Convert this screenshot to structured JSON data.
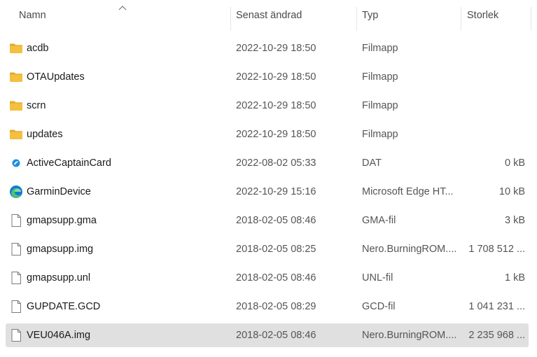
{
  "columns": {
    "name": "Namn",
    "date": "Senast ändrad",
    "type": "Typ",
    "size": "Storlek"
  },
  "files": [
    {
      "name": "acdb",
      "date": "2022-10-29 18:50",
      "type": "Filmapp",
      "size": "",
      "icon": "folder-icon"
    },
    {
      "name": "OTAUpdates",
      "date": "2022-10-29 18:50",
      "type": "Filmapp",
      "size": "",
      "icon": "folder-icon"
    },
    {
      "name": "scrn",
      "date": "2022-10-29 18:50",
      "type": "Filmapp",
      "size": "",
      "icon": "folder-icon"
    },
    {
      "name": "updates",
      "date": "2022-10-29 18:50",
      "type": "Filmapp",
      "size": "",
      "icon": "folder-icon"
    },
    {
      "name": "ActiveCaptainCard",
      "date": "2022-08-02 05:33",
      "type": "DAT",
      "size": "0 kB",
      "icon": "activecaptain-icon"
    },
    {
      "name": "GarminDevice",
      "date": "2022-10-29 15:16",
      "type": "Microsoft Edge HT...",
      "size": "10 kB",
      "icon": "edge-icon"
    },
    {
      "name": "gmapsupp.gma",
      "date": "2018-02-05 08:46",
      "type": "GMA-fil",
      "size": "3 kB",
      "icon": "file-icon"
    },
    {
      "name": "gmapsupp.img",
      "date": "2018-02-05 08:25",
      "type": "Nero.BurningROM....",
      "size": "1 708 512 ...",
      "icon": "file-icon"
    },
    {
      "name": "gmapsupp.unl",
      "date": "2018-02-05 08:46",
      "type": "UNL-fil",
      "size": "1 kB",
      "icon": "file-icon"
    },
    {
      "name": "GUPDATE.GCD",
      "date": "2018-02-05 08:29",
      "type": "GCD-fil",
      "size": "1 041 231 ...",
      "icon": "file-icon"
    },
    {
      "name": "VEU046A.img",
      "date": "2018-02-05 08:46",
      "type": "Nero.BurningROM....",
      "size": "2 235 968 ...",
      "icon": "file-icon",
      "selected": true
    }
  ],
  "colors": {
    "folder": "#f3c03f",
    "folder_back": "#e3a82b",
    "selection": "#e0e0e0",
    "edge_blue": "#0f7bd8",
    "edge_green": "#52c26b"
  }
}
